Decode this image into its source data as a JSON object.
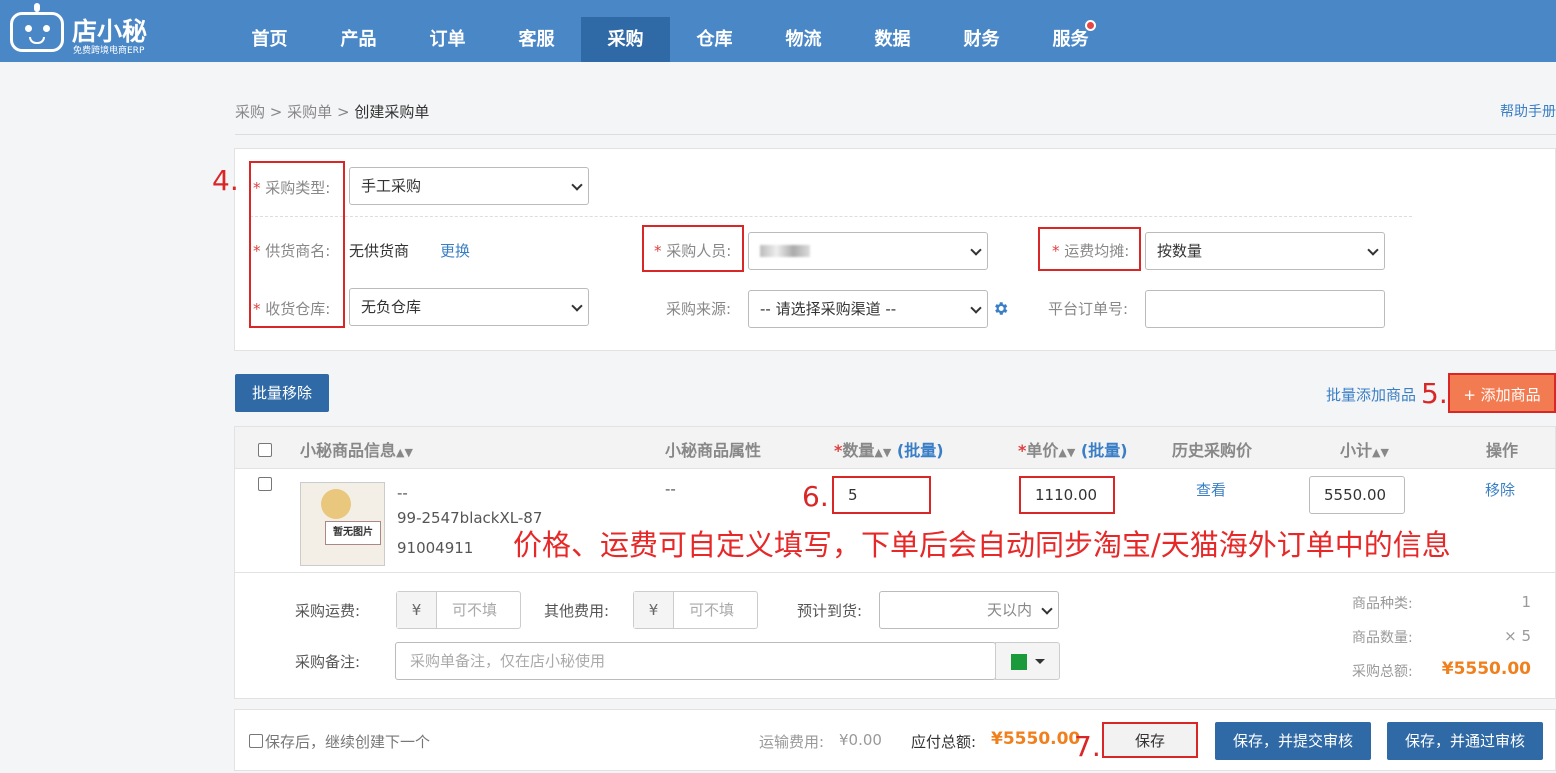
{
  "app": {
    "logo_name": "店小秘",
    "logo_sub": "免费跨境电商ERP"
  },
  "nav": [
    "首页",
    "产品",
    "订单",
    "客服",
    "采购",
    "仓库",
    "物流",
    "数据",
    "财务",
    "服务"
  ],
  "breadcrumb": {
    "a": "采购",
    "sep": ">",
    "b": "采购单",
    "c": "创建采购单"
  },
  "help": "帮助手册",
  "form": {
    "type_label": "采购类型:",
    "type_value": "手工采购",
    "supplier_label": "供货商名:",
    "supplier_value": "无供货商",
    "supplier_change": "更换",
    "warehouse_label": "收货仓库:",
    "warehouse_value": "无负仓库",
    "buyer_label": "采购人员:",
    "freight_label": "运费均摊:",
    "freight_value": "按数量",
    "source_label": "采购来源:",
    "source_value": "-- 请选择采购渠道 --",
    "platform_label": "平台订单号:"
  },
  "actions": {
    "batch_remove": "批量移除",
    "batch_add": "批量添加商品",
    "add": "+ 添加商品"
  },
  "table": {
    "headers": {
      "info": "小秘商品信息",
      "attr": "小秘商品属性",
      "qty": "数量",
      "qty_batch": "(批量)",
      "price": "单价",
      "price_batch": "(批量)",
      "history": "历史采购价",
      "subtotal": "小计",
      "op": "操作"
    },
    "row": {
      "thumb_text": "暂无图片",
      "name": "--",
      "sku": "99-2547blackXL-87",
      "id": "91004911",
      "attr": "--",
      "qty": "5",
      "price": "1110.00",
      "history": "查看",
      "subtotal": "5550.00",
      "op": "移除"
    }
  },
  "note": "价格、运费可自定义填写，下单后会自动同步淘宝/天猫海外订单中的信息",
  "extra": {
    "freight_label": "采购运费:",
    "currency": "¥",
    "freight_ph": "可不填",
    "other_label": "其他费用:",
    "other_ph": "可不填",
    "eta_label": "预计到货:",
    "eta_unit": "天以内",
    "remark_label": "采购备注:",
    "remark_ph": "采购单备注，仅在店小秘使用"
  },
  "summary": {
    "kinds_label": "商品种类:",
    "kinds": "1",
    "qty_label": "商品数量:",
    "qty": "× 5",
    "total_label": "采购总额:",
    "total": "¥5550.00"
  },
  "footer": {
    "continue_label": "保存后，继续创建下一个",
    "shipping_label": "运输费用:",
    "shipping": "¥0.00",
    "payable_label": "应付总额:",
    "payable": "¥5550.00",
    "save": "保存",
    "save_submit": "保存，并提交审核",
    "save_approve": "保存，并通过审核"
  },
  "markers": {
    "m4": "4.",
    "m5": "5.",
    "m6": "6.",
    "m7": "7."
  },
  "colors": {
    "nav": "#4a87c7",
    "nav_active": "#2f6aa7",
    "accent_orange": "#f37b51",
    "annotation_red": "#d92727"
  }
}
